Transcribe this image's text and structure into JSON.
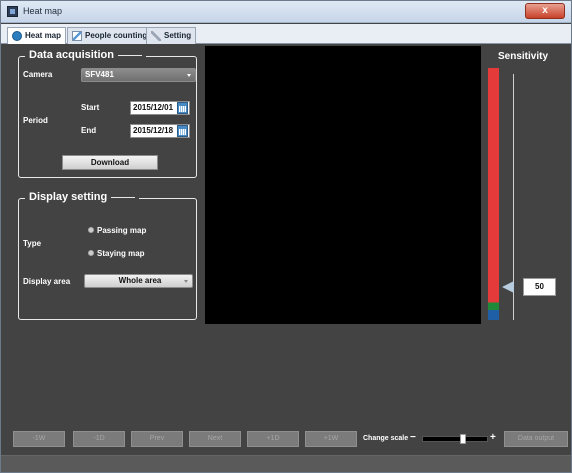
{
  "window": {
    "title": "Heat map",
    "close_glyph": "x"
  },
  "tabs": [
    {
      "label": "Heat map",
      "icon": "heat-map-icon",
      "active": true
    },
    {
      "label": "People counting",
      "icon": "chart-icon",
      "active": false
    },
    {
      "label": "Setting",
      "icon": "wrench-icon",
      "active": false
    }
  ],
  "data_acquisition": {
    "title": "Data acquisition",
    "camera_label": "Camera",
    "camera_value": "SFV481",
    "period_label": "Period",
    "start_label": "Start",
    "start_value": "2015/12/01",
    "end_label": "End",
    "end_value": "2015/12/18",
    "download_label": "Download"
  },
  "display_setting": {
    "title": "Display setting",
    "type_label": "Type",
    "type_options": [
      "Passing map",
      "Staying map"
    ],
    "area_label": "Display area",
    "area_value": "Whole area"
  },
  "sensitivity": {
    "title": "Sensitivity",
    "value": "50",
    "colors": {
      "red": "#e53a3a",
      "green": "#1f8a3a",
      "blue": "#1f5fa8"
    }
  },
  "bottom": {
    "buttons": [
      "-1W",
      "-1D",
      "Prev",
      "Next",
      "+1D",
      "+1W"
    ],
    "change_scale_label": "Change scale",
    "minus": "−",
    "plus": "+",
    "data_output_label": "Data output"
  }
}
